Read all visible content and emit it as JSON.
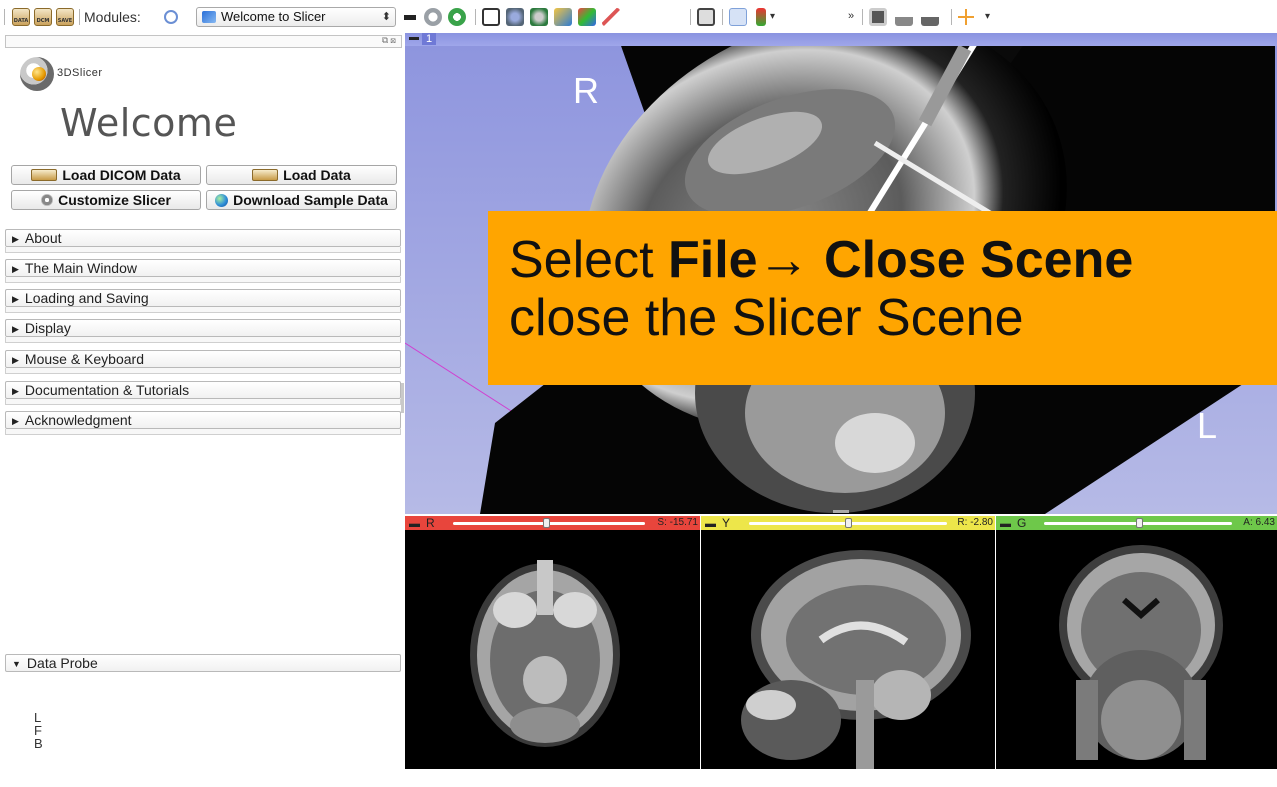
{
  "toolbar": {
    "data_icon_label": "DATA",
    "dcm_icon_label": "DCM",
    "save_icon_label": "SAVE",
    "modules_label": "Modules:",
    "module_selected": "Welcome to Slicer",
    "more_chevron": "»"
  },
  "panel": {
    "logo_text": "3DSlicer",
    "title": "Welcome",
    "buttons": {
      "load_dicom": "Load DICOM Data",
      "load_data": "Load Data",
      "customize": "Customize Slicer",
      "download_sample": "Download Sample Data"
    },
    "sections": [
      "About",
      "The Main Window",
      "Loading and Saving",
      "Display",
      "Mouse & Keyboard",
      "Documentation & Tutorials",
      "Acknowledgment"
    ],
    "data_probe": "Data Probe",
    "probe_labels": [
      "L",
      "F",
      "B"
    ]
  },
  "view3d": {
    "number": "1",
    "orient_left": "R",
    "orient_right": "L"
  },
  "callout": {
    "line1_prefix": "Select ",
    "line1_bold": "File→ Close Scene",
    "line2": "close the Slicer Scene"
  },
  "slices": {
    "red": {
      "name": "R",
      "value": "S: -15.71",
      "bar_color": "#e8453c",
      "track_color": "#ffffff"
    },
    "yellow": {
      "name": "Y",
      "value": "R: -2.80",
      "bar_color": "#ede64a",
      "track_color": "#ffffff"
    },
    "green": {
      "name": "G",
      "value": "A: 6.43",
      "bar_color": "#6ec84a",
      "track_color": "#ffffff"
    }
  }
}
